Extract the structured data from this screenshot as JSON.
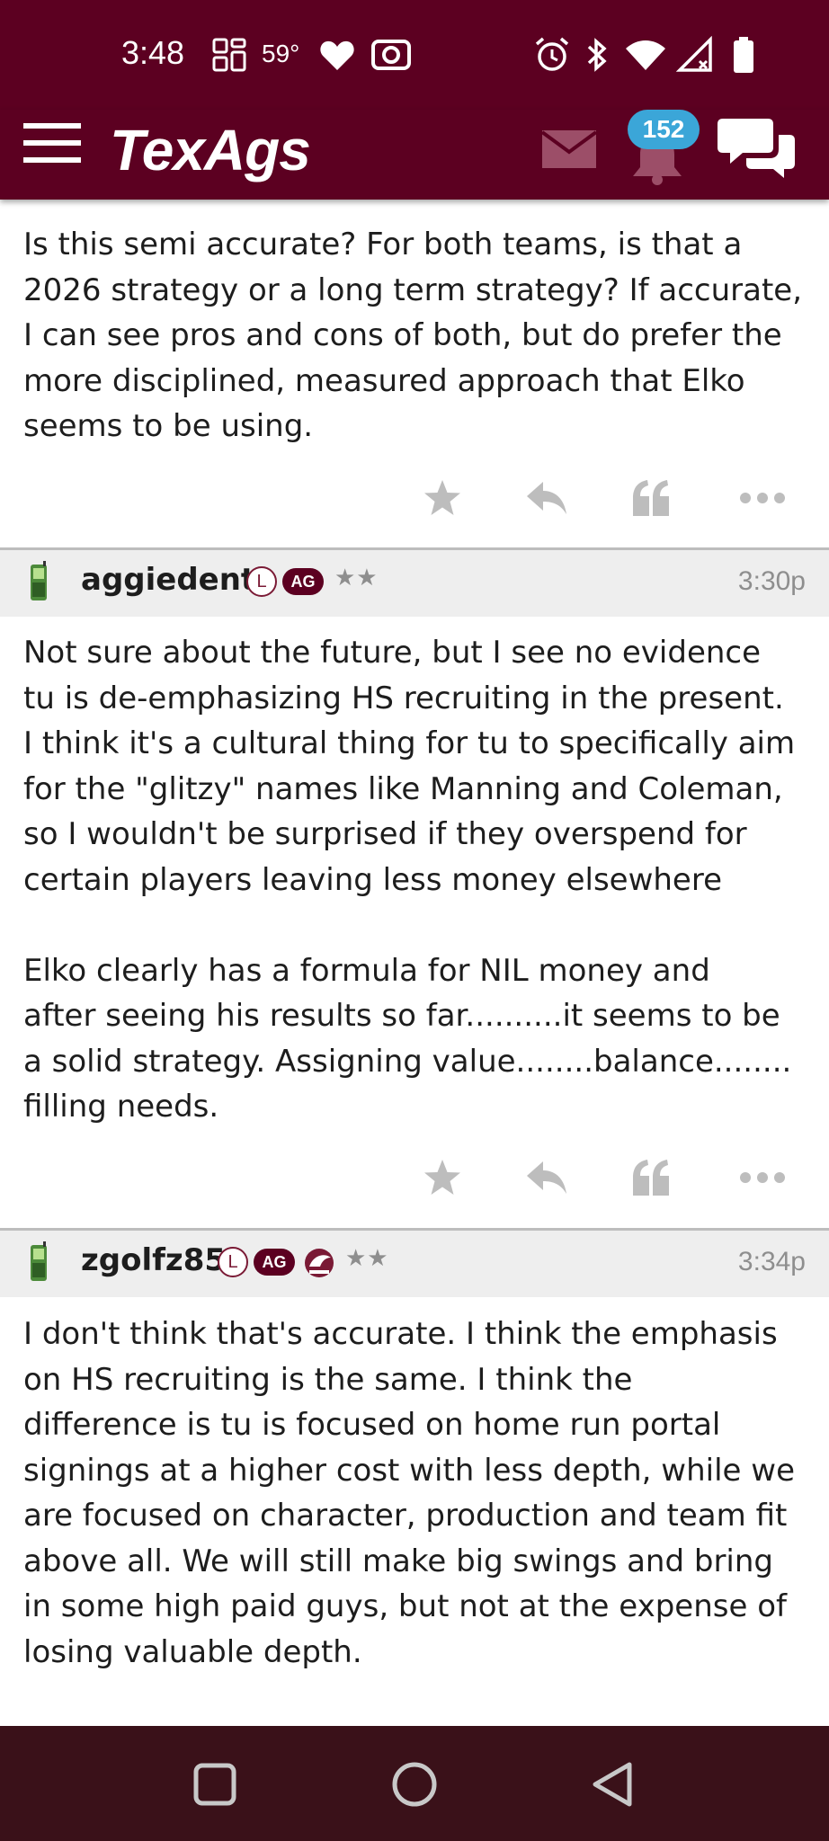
{
  "status_bar": {
    "time": "3:48",
    "temperature": "59°",
    "icons": [
      "grid-icon",
      "heart-icon",
      "camera-icon",
      "alarm-icon",
      "bluetooth-icon",
      "wifi-icon",
      "signal-icon",
      "battery-icon"
    ]
  },
  "header": {
    "logo": "TexAgs",
    "notification_count": "152",
    "icons": [
      "menu-icon",
      "mail-icon",
      "bell-icon",
      "chat-icon"
    ]
  },
  "posts": [
    {
      "text": "Is this semi accurate? For both teams, is that a\n2026 strategy or a long term strategy? If accurate,\nI can see pros and cons of both, but do prefer the\nmore disciplined, measured approach that Elko\nseems to be using."
    },
    {
      "username": "aggiedent",
      "badge_l": "L",
      "badge_ag": "AG",
      "stars": "★★",
      "time": "3:30p",
      "text": "Not sure about the future, but I see no evidence\ntu is de-emphasizing HS recruiting in the present.\nI think it's a cultural thing for tu to specifically aim\nfor the \"glitzy\" names like Manning and Coleman,\nso I wouldn't be surprised if they overspend for\ncertain players leaving less money elsewhere\n\nElko clearly has a formula for NIL money and\nafter seeing his results so far..........it seems to be\na solid strategy. Assigning value........balance........\nfilling needs."
    },
    {
      "username": "zgolfz85",
      "badge_l": "L",
      "badge_ag": "AG",
      "stars": "★★",
      "time": "3:34p",
      "text": "I don't think that's accurate. I think the emphasis\non HS recruiting is the same. I think the\ndifference is tu is focused on home run portal\nsignings at a higher cost with less depth, while we\nare focused on character, production and team fit\nabove all. We will still make big swings and bring\nin some high paid guys, but not at the expense of\nlosing valuable depth."
    }
  ],
  "post_actions": [
    "star-icon",
    "reply-icon",
    "quote-icon",
    "more-icon"
  ],
  "nav_bar": [
    "recents-icon",
    "home-icon",
    "back-icon"
  ],
  "colors": {
    "maroon": "#5c0021",
    "badge_blue": "#3ba6d8",
    "header_gray": "#eeeeee",
    "icon_gray": "#bdbdbd",
    "nav_bg": "#3a1119"
  }
}
